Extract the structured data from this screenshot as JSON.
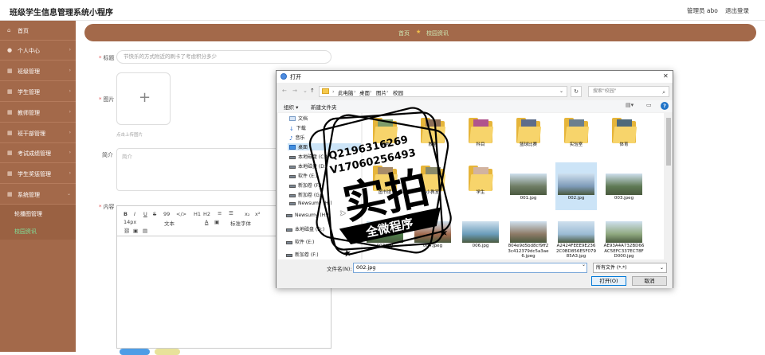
{
  "header": {
    "app_title": "班级学生信息管理系统小程序",
    "admin_label": "管理员 abo",
    "logout_label": "退出登录"
  },
  "sidebar": {
    "items": [
      {
        "label": "首页",
        "icon": "home-icon"
      },
      {
        "label": "个人中心",
        "icon": "user-icon"
      },
      {
        "label": "班级管理",
        "icon": "grid-icon"
      },
      {
        "label": "学生管理",
        "icon": "grid-icon"
      },
      {
        "label": "教师管理",
        "icon": "grid-icon"
      },
      {
        "label": "班干部管理",
        "icon": "grid-icon"
      },
      {
        "label": "考试成绩管理",
        "icon": "grid-icon"
      },
      {
        "label": "学生奖惩管理",
        "icon": "grid-icon"
      },
      {
        "label": "系统管理",
        "icon": "grid-icon"
      }
    ],
    "sub_items": [
      {
        "label": "轮播图管理"
      },
      {
        "label": "校园资讯"
      }
    ]
  },
  "breadcrumb": {
    "home": "首页",
    "current": "校园资讯"
  },
  "form": {
    "title_label": "标题",
    "title_value": "节快乐的方式附近的刷卡了考虑积分多少",
    "image_label": "图片",
    "upload_tip": "点击上传图片",
    "intro_label": "简介",
    "intro_placeholder": "简介",
    "content_label": "内容",
    "editor_toolbar": {
      "bold": "B",
      "italic": "I",
      "underline": "U",
      "strike": "S",
      "quote": "99",
      "code": "</>",
      "h1": "H1",
      "h2": "H2",
      "subscript": "x₂",
      "superscript": "x²",
      "size": "14px",
      "style": "文本",
      "font": "标准字体"
    }
  },
  "dialog": {
    "title": "打开",
    "path": [
      "此电脑",
      "桌面",
      "图片",
      "校园"
    ],
    "search_placeholder": "搜索\"校园\"",
    "organize_label": "组织 ▾",
    "new_folder_label": "新建文件夹",
    "help_label": "?",
    "nav_items": [
      {
        "label": "文档",
        "type": "doc"
      },
      {
        "label": "下载",
        "type": "download"
      },
      {
        "label": "音乐",
        "type": "music"
      },
      {
        "label": "桌面",
        "type": "desktop",
        "selected": true
      },
      {
        "label": "本地磁盘 (C:)",
        "type": "drive"
      },
      {
        "label": "本地磁盘 (D:)",
        "type": "drive"
      },
      {
        "label": "软件 (E:)",
        "type": "drive"
      },
      {
        "label": "新加卷 (F:)",
        "type": "drive"
      },
      {
        "label": "新加卷 (G:)",
        "type": "drive"
      },
      {
        "label": "Newsumy (H:)",
        "type": "drive"
      },
      {
        "label": "Newsumy (H:)",
        "type": "drive"
      },
      {
        "label": "本地磁盘 (D:)",
        "type": "drive"
      },
      {
        "label": "软件 (E:)",
        "type": "drive"
      },
      {
        "label": "新加卷 (F:)",
        "type": "drive"
      }
    ],
    "files": [
      {
        "name": "",
        "kind": "folder",
        "color": "#d9d9d9"
      },
      {
        "name": "宿舍",
        "kind": "folder",
        "color": "#7e9c6a"
      },
      {
        "name": "教室",
        "kind": "folder",
        "color": "#8c6e58"
      },
      {
        "name": "科目",
        "kind": "folder",
        "color": "#b0548d"
      },
      {
        "name": "篮球比赛",
        "kind": "folder",
        "color": "#5e6d8a"
      },
      {
        "name": "实验室",
        "kind": "folder",
        "color": "#6b7f8e"
      },
      {
        "name": "体育",
        "kind": "folder",
        "color": "#4f6a7a"
      },
      {
        "name": "",
        "kind": "folder",
        "color": "#cfcfcf"
      },
      {
        "name": "图书馆",
        "kind": "folder",
        "color": "#a88c6a"
      },
      {
        "name": "小教室",
        "kind": "folder",
        "color": "#8a8a6a"
      },
      {
        "name": "学生",
        "kind": "folder",
        "color": "#d2b3a0"
      },
      {
        "name": "001.jpg",
        "kind": "image",
        "color": "#6f7d65"
      },
      {
        "name": "002.jpg",
        "kind": "image",
        "color": "#7d9ab8",
        "selected": true
      },
      {
        "name": "003.jpeg",
        "kind": "image",
        "color": "#5f7a55"
      },
      {
        "name": "",
        "kind": "image",
        "color": "#6a8a58"
      },
      {
        "name": "003.jpg",
        "kind": "image",
        "color": "#4f7e4a"
      },
      {
        "name": "004.jpeg",
        "kind": "image",
        "color": "#a36b4f"
      },
      {
        "name": "006.jpg",
        "kind": "image",
        "color": "#6a9cb9"
      },
      {
        "name": "804e9d5bd8cf9ff23c412379dc5a3ae6.jpeg",
        "kind": "image",
        "color": "#8d7a66"
      },
      {
        "name": "A2424FEEE9E2362C0BD856E5F07985A3.jpg",
        "kind": "image",
        "color": "#9bbbd4"
      },
      {
        "name": "AE93A4A732BD66AC5EFC337EC78FD000.jpg",
        "kind": "image",
        "color": "#8fa87f"
      }
    ],
    "filename_label": "文件名(N):",
    "filename_value": "002.jpg",
    "filetype_value": "所有文件 (*.*)",
    "open_label": "打开(O)",
    "cancel_label": "取消"
  },
  "stamp": {
    "line1": "Q2196316269",
    "line2": "V17060256493",
    "big": "实拍",
    "ribbon": "全微程序"
  },
  "colors": {
    "accent": "#a3694a",
    "breadcrumb_text": "#cde9b5",
    "active_sub": "#7fe39a"
  }
}
